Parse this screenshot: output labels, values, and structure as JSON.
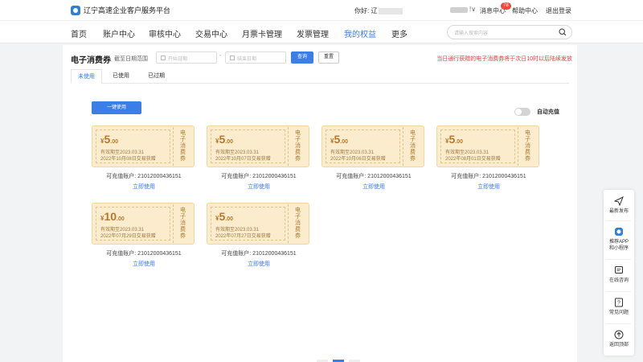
{
  "header": {
    "site_title": "辽宁高速企业客户服务平台",
    "greeting": "你好: 辽",
    "messages_label": "消息中心",
    "messages_badge": "78",
    "help_label": "帮助中心",
    "logout_label": "退出登录"
  },
  "nav": {
    "items": [
      "首页",
      "账户中心",
      "审核中心",
      "交易中心",
      "月票卡管理",
      "发票管理",
      "我的权益",
      "更多"
    ],
    "active_index": 6,
    "search_placeholder": "请输入搜索内容"
  },
  "filter": {
    "title": "电子消费券",
    "date_range_label": "截至日期范围",
    "start_placeholder": "开始日期",
    "end_placeholder": "结束日期",
    "separator": "-",
    "query_label": "查询",
    "reset_label": "重置",
    "notice": "当日通行获赠的电子消费券将于次日10时以后陆续发放"
  },
  "tabs": {
    "items": [
      "未使用",
      "已使用",
      "已过期"
    ],
    "active_index": 0
  },
  "actions": {
    "use_all_label": "一键使用",
    "auto_recharge_label": "自动充值",
    "auto_recharge_on": false
  },
  "coupons": [
    {
      "yen": "¥",
      "amount": "5",
      "decimal": ".00",
      "validity": "有效期至2023.03.31",
      "acquired": "2022年10月08日交易获赠",
      "side_label": [
        "电",
        "子",
        "消",
        "费",
        "券"
      ],
      "account": "可充值账户: 21012000436151",
      "use_label": "立即使用"
    },
    {
      "yen": "¥",
      "amount": "5",
      "decimal": ".00",
      "validity": "有效期至2023.03.31",
      "acquired": "2022年10月07日交易获赠",
      "side_label": [
        "电",
        "子",
        "消",
        "费",
        "券"
      ],
      "account": "可充值账户: 21012000436151",
      "use_label": "立即使用"
    },
    {
      "yen": "¥",
      "amount": "5",
      "decimal": ".00",
      "validity": "有效期至2023.03.31",
      "acquired": "2022年10月06日交易获赠",
      "side_label": [
        "电",
        "子",
        "消",
        "费",
        "券"
      ],
      "account": "可充值账户: 21012000436151",
      "use_label": "立即使用"
    },
    {
      "yen": "¥",
      "amount": "5",
      "decimal": ".00",
      "validity": "有效期至2023.03.31",
      "acquired": "2022年08月01日交易获赠",
      "side_label": [
        "电",
        "子",
        "消",
        "费",
        "券"
      ],
      "account": "可充值账户: 21012000436151",
      "use_label": "立即使用"
    },
    {
      "yen": "¥",
      "amount": "10",
      "decimal": ".00",
      "validity": "有效期至2023.03.31",
      "acquired": "2022年07月29日交易获赠",
      "side_label": [
        "电",
        "子",
        "消",
        "费",
        "券"
      ],
      "account": "可充值账户: 21012000436151",
      "use_label": "立即使用"
    },
    {
      "yen": "¥",
      "amount": "5",
      "decimal": ".00",
      "validity": "有效期至2023.03.31",
      "acquired": "2022年07月27日交易获赠",
      "side_label": [
        "电",
        "子",
        "消",
        "费",
        "券"
      ],
      "account": "可充值账户: 21012000436151",
      "use_label": "立即使用"
    }
  ],
  "float_bar": {
    "items": [
      {
        "icon": "paper-plane-icon",
        "label": "最新发布"
      },
      {
        "icon": "app-logo-icon",
        "label": "推荐APP和小程序"
      },
      {
        "icon": "chat-icon",
        "label": "在线咨询"
      },
      {
        "icon": "question-icon",
        "label": "常见问题"
      },
      {
        "icon": "arrow-up-icon",
        "label": "返回顶部"
      }
    ]
  },
  "colors": {
    "accent": "#3a7ee8",
    "notice": "#e0403a",
    "coupon_bg": "#fbeccd",
    "coupon_text": "#b57a2a"
  }
}
